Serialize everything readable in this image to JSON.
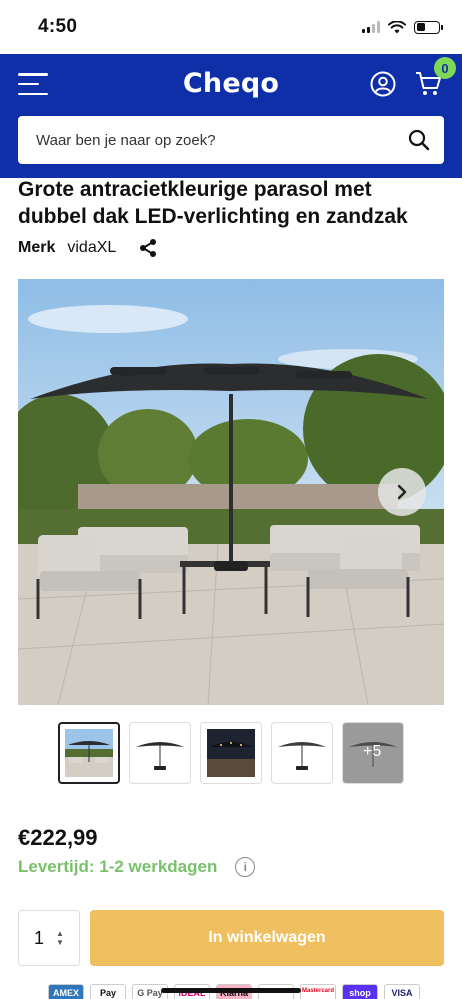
{
  "status_bar": {
    "time": "4:50"
  },
  "header": {
    "logo": "Cheqo",
    "cart_count": "0",
    "search_placeholder": "Waar ben je naar op zoek?"
  },
  "product": {
    "title": "Grote antracietkleurige parasol met dubbel dak LED-verlichting en zandzak",
    "brand_label": "Merk",
    "brand_value": "vidaXL",
    "price": "€222,99",
    "delivery": "Levertijd: 1-2 werkdagen",
    "quantity": "1",
    "add_to_cart": "In winkelwagen",
    "more_images": "+5"
  },
  "payment_methods": [
    "AMEX",
    "Pay",
    "G Pay",
    "iDEAL",
    "Klarna",
    "Maestro",
    "Mastercard",
    "shop",
    "VISA"
  ],
  "colors": {
    "brand_blue": "#0f2fa8",
    "badge_green": "#7ed957",
    "delivery_green": "#7ac16b",
    "cart_button": "#f0c060"
  }
}
